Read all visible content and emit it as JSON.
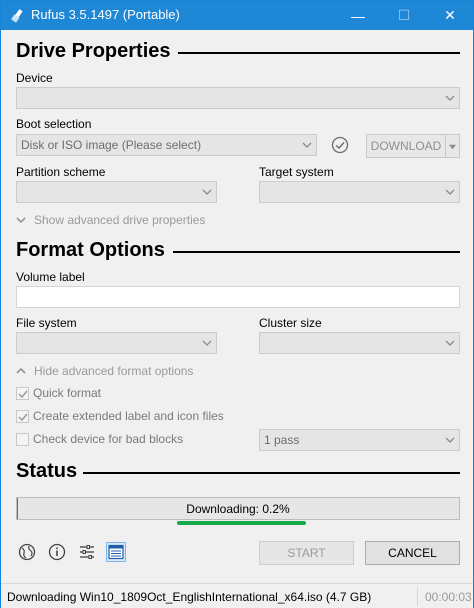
{
  "window": {
    "title": "Rufus 3.5.1497 (Portable)",
    "minimize_glyph": "—",
    "maximize_glyph": "☐",
    "close_glyph": "✕"
  },
  "drive_properties": {
    "heading": "Drive Properties",
    "device_label": "Device",
    "device_value": "",
    "boot_selection_label": "Boot selection",
    "boot_selection_value": "Disk or ISO image (Please select)",
    "download_button": "DOWNLOAD",
    "partition_scheme_label": "Partition scheme",
    "partition_scheme_value": "",
    "target_system_label": "Target system",
    "target_system_value": "",
    "advanced_toggle": "Show advanced drive properties"
  },
  "format_options": {
    "heading": "Format Options",
    "volume_label_label": "Volume label",
    "volume_label_value": "",
    "file_system_label": "File system",
    "file_system_value": "",
    "cluster_size_label": "Cluster size",
    "cluster_size_value": "",
    "advanced_toggle": "Hide advanced format options",
    "quick_format": {
      "label": "Quick format",
      "checked": true
    },
    "extended_label": {
      "label": "Create extended label and icon files",
      "checked": true
    },
    "bad_blocks": {
      "label": "Check device for bad blocks",
      "checked": false
    },
    "passes_value": "1 pass"
  },
  "status": {
    "heading": "Status",
    "progress_text": "Downloading: 0.2%",
    "progress_fraction": 0.002
  },
  "toolbar": {
    "icons": [
      "language-icon",
      "info-icon",
      "settings-icon",
      "log-icon"
    ],
    "start_button": "START",
    "cancel_button": "CANCEL"
  },
  "statusbar": {
    "message": "Downloading Win10_1809Oct_EnglishInternational_x64.iso (4.7 GB)",
    "timer": "00:00:03"
  },
  "colors": {
    "titlebar": "#1e87d6",
    "progress_fill": "#06b025",
    "accent_line": "#17a84a"
  }
}
